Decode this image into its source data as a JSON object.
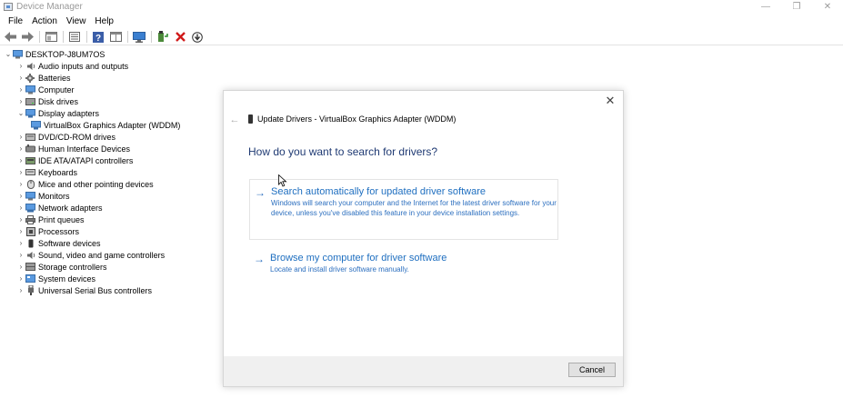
{
  "window": {
    "title": "Device Manager",
    "minimize_glyph": "—",
    "restore_glyph": "❐",
    "close_glyph": "✕"
  },
  "menu": {
    "items": [
      {
        "label": "File"
      },
      {
        "label": "Action"
      },
      {
        "label": "View"
      },
      {
        "label": "Help"
      }
    ]
  },
  "toolbar": {
    "buttons": [
      {
        "icon": "back-arrow-icon"
      },
      {
        "icon": "forward-arrow-icon"
      },
      {
        "icon": "properties-window-icon"
      },
      {
        "icon": "list-view-icon"
      },
      {
        "icon": "help-icon"
      },
      {
        "icon": "details-view-icon"
      },
      {
        "icon": "monitor-scan-icon"
      },
      {
        "icon": "update-driver-icon"
      },
      {
        "icon": "uninstall-x-icon"
      },
      {
        "icon": "download-circle-icon"
      }
    ]
  },
  "tree": {
    "root": "DESKTOP-J8UM7OS",
    "categories": [
      {
        "label": "Audio inputs and outputs",
        "icon": "speaker-icon"
      },
      {
        "label": "Batteries",
        "icon": "battery-icon"
      },
      {
        "label": "Computer",
        "icon": "computer-icon"
      },
      {
        "label": "Disk drives",
        "icon": "disk-drive-icon"
      },
      {
        "label": "Display adapters",
        "icon": "display-adapter-icon",
        "expanded": true,
        "children": [
          {
            "label": "VirtualBox Graphics Adapter (WDDM)",
            "icon": "display-adapter-icon"
          }
        ]
      },
      {
        "label": "DVD/CD-ROM drives",
        "icon": "dvd-drive-icon"
      },
      {
        "label": "Human Interface Devices",
        "icon": "hid-icon"
      },
      {
        "label": "IDE ATA/ATAPI controllers",
        "icon": "ide-controller-icon"
      },
      {
        "label": "Keyboards",
        "icon": "keyboard-icon"
      },
      {
        "label": "Mice and other pointing devices",
        "icon": "mouse-icon"
      },
      {
        "label": "Monitors",
        "icon": "monitor-icon"
      },
      {
        "label": "Network adapters",
        "icon": "network-adapter-icon"
      },
      {
        "label": "Print queues",
        "icon": "printer-icon"
      },
      {
        "label": "Processors",
        "icon": "processor-icon"
      },
      {
        "label": "Software devices",
        "icon": "software-device-icon"
      },
      {
        "label": "Sound, video and game controllers",
        "icon": "sound-controller-icon"
      },
      {
        "label": "Storage controllers",
        "icon": "storage-controller-icon"
      },
      {
        "label": "System devices",
        "icon": "system-device-icon"
      },
      {
        "label": "Universal Serial Bus controllers",
        "icon": "usb-icon"
      }
    ]
  },
  "dialog": {
    "title": "Update Drivers - VirtualBox Graphics Adapter (WDDM)",
    "question": "How do you want to search for drivers?",
    "close_glyph": "✕",
    "back_glyph": "←",
    "options": [
      {
        "title": "Search automatically for updated driver software",
        "description": "Windows will search your computer and the Internet for the latest driver software for your device, unless you've disabled this feature in your device installation settings."
      },
      {
        "title": "Browse my computer for driver software",
        "description": "Locate and install driver software manually."
      }
    ],
    "arrow_glyph": "→",
    "cancel_label": "Cancel"
  },
  "colors": {
    "link_blue": "#1f6fc0",
    "heading_navy": "#1f3a73",
    "footer_gray": "#f0f0f0"
  }
}
